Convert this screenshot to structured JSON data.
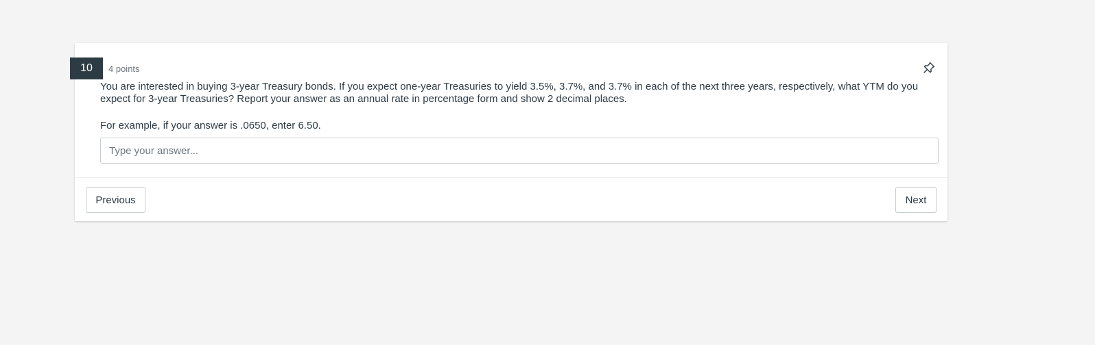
{
  "question": {
    "number": "10",
    "points": "4 points",
    "prompt": "You are interested in buying 3-year Treasury bonds. If you expect one-year Treasuries to yield 3.5%, 3.7%, and 3.7% in each of the next three years, respectively, what YTM do you expect for 3-year Treasuries? Report your answer as an annual rate in percentage form and show 2 decimal places.",
    "example": "For example, if your answer is .0650, enter 6.50.",
    "answer_value": "",
    "answer_placeholder": "Type your answer...",
    "pin_icon": "pushpin-icon"
  },
  "navigation": {
    "previous_label": "Previous",
    "next_label": "Next"
  },
  "colors": {
    "page_background": "#f4f4f4",
    "card_background": "#ffffff",
    "badge_background": "#2d3b45",
    "text": "#2d3b45",
    "muted_text": "#6b7780",
    "border": "#c7cdd1"
  }
}
